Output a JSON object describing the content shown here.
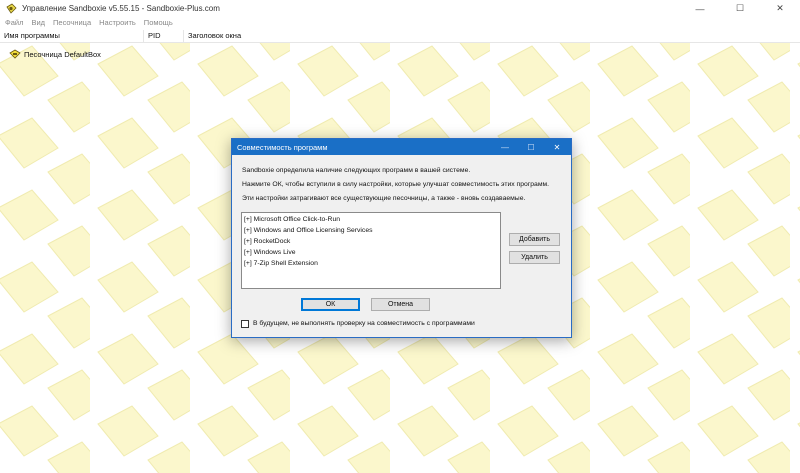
{
  "window": {
    "title": "Управление Sandboxie v5.55.15 - Sandboxie-Plus.com",
    "controls": {
      "minimize": "—",
      "maximize": "☐",
      "close": "✕"
    }
  },
  "menu": [
    "Файл",
    "Вид",
    "Песочница",
    "Настроить",
    "Помощь"
  ],
  "columns": {
    "name": "Имя программы",
    "pid": "PID",
    "title": "Заголовок окна"
  },
  "tree": {
    "sandbox_label": "Песочница DefaultBox"
  },
  "colors": {
    "accent": "#1a6fc6",
    "pattern_fill": "#fbf7cc",
    "pattern_stroke": "#f0ebb0"
  },
  "icons": {
    "app": "sandboxie-icon",
    "sandbox": "sandbox-icon"
  },
  "dialog": {
    "title": "Совместимость программ",
    "controls": {
      "minimize": "—",
      "maximize": "☐",
      "close": "✕"
    },
    "line1": "Sandboxie определила наличие следующих программ в вашей системе.",
    "line2": "Нажмите ОК, чтобы вступили в силу настройки, которые улучшат совместимость этих программ.",
    "line3": "Эти настройки затрагивают все существующие песочницы, а также - вновь создаваемые.",
    "programs": [
      "[+]  Microsoft Office Click-to-Run",
      "[+]  Windows and Office Licensing Services",
      "[+]  RocketDock",
      "[+]  Windows Live",
      "[+]  7-Zip Shell Extension"
    ],
    "add_button": "Добавить",
    "remove_button": "Удалить",
    "ok_button": "ОК",
    "cancel_button": "Отмена",
    "checkbox_label": "В будущем, не выполнять проверку на совместимость с программами",
    "checkbox_checked": false
  }
}
